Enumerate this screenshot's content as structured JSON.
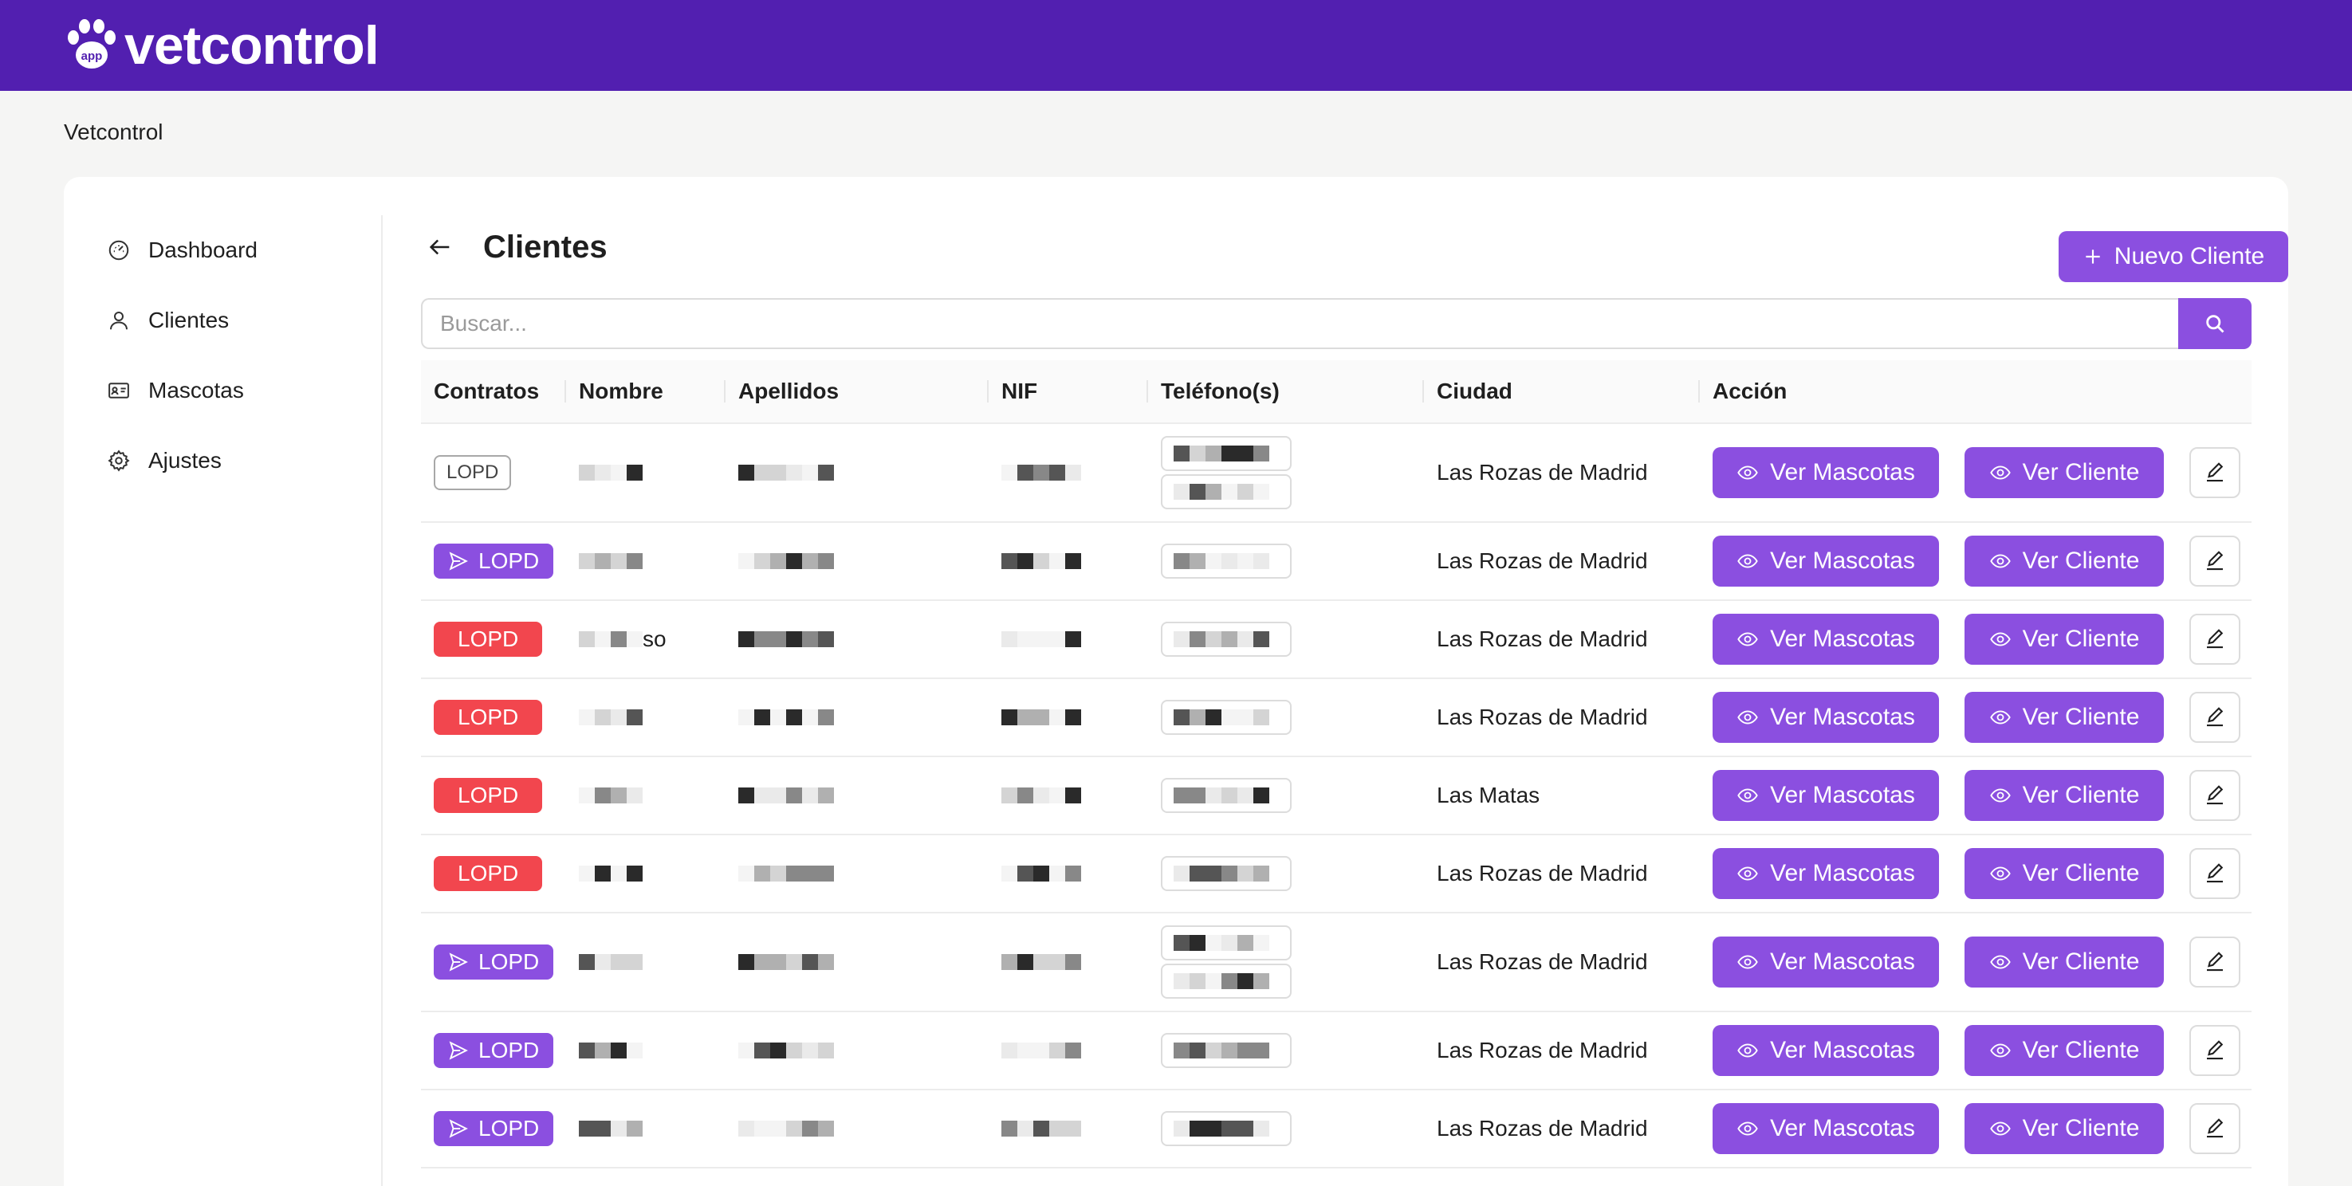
{
  "brand": {
    "name": "vetcontrol",
    "badge": "app"
  },
  "breadcrumb": "Vetcontrol",
  "sidebar": {
    "items": [
      {
        "label": "Dashboard",
        "icon": "gauge-icon"
      },
      {
        "label": "Clientes",
        "icon": "user-icon"
      },
      {
        "label": "Mascotas",
        "icon": "id-card-icon"
      },
      {
        "label": "Ajustes",
        "icon": "gear-icon"
      }
    ]
  },
  "page": {
    "title": "Clientes",
    "new_button": "Nuevo Cliente"
  },
  "search": {
    "placeholder": "Buscar..."
  },
  "table": {
    "headers": [
      "Contratos",
      "Nombre",
      "Apellidos",
      "NIF",
      "Teléfono(s)",
      "Ciudad",
      "Acción"
    ],
    "action_labels": {
      "mascotas": "Ver Mascotas",
      "cliente": "Ver Cliente"
    },
    "rows": [
      {
        "contract": "LOPD",
        "status": "outline",
        "city": "Las Rozas de Madrid",
        "name_suffix": ""
      },
      {
        "contract": "LOPD",
        "status": "sent",
        "city": "Las Rozas de Madrid",
        "name_suffix": ""
      },
      {
        "contract": "LOPD",
        "status": "missing",
        "city": "Las Rozas de Madrid",
        "name_suffix": "so"
      },
      {
        "contract": "LOPD",
        "status": "missing",
        "city": "Las Rozas de Madrid",
        "name_suffix": ""
      },
      {
        "contract": "LOPD",
        "status": "missing",
        "city": "Las Matas",
        "name_suffix": ""
      },
      {
        "contract": "LOPD",
        "status": "missing",
        "city": "Las Rozas de Madrid",
        "name_suffix": ""
      },
      {
        "contract": "LOPD",
        "status": "sent",
        "city": "Las Rozas de Madrid",
        "name_suffix": ""
      },
      {
        "contract": "LOPD",
        "status": "sent",
        "city": "Las Rozas de Madrid",
        "name_suffix": ""
      },
      {
        "contract": "LOPD",
        "status": "sent",
        "city": "Las Rozas de Madrid",
        "name_suffix": ""
      }
    ]
  },
  "colors": {
    "header": "#521fb0",
    "primary": "#8b4fe0",
    "danger": "#f2464e",
    "background": "#f5f5f4"
  }
}
